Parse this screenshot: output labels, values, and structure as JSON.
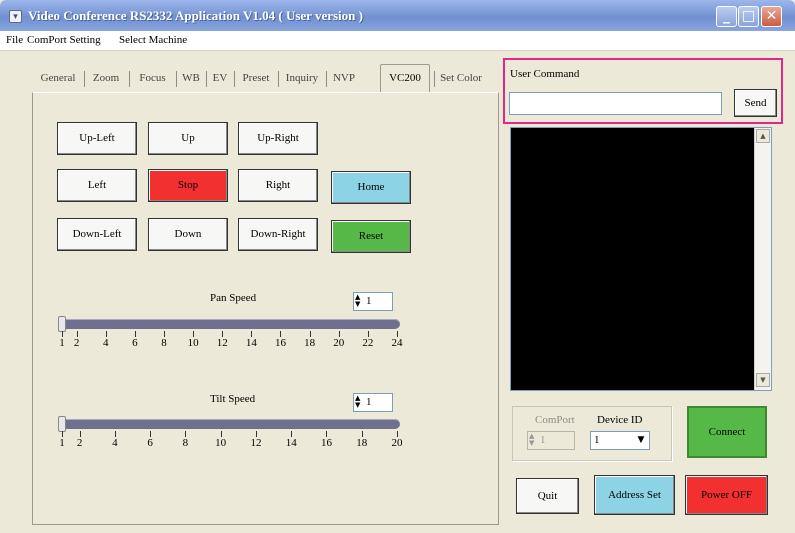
{
  "window": {
    "title": "Video Conference RS2332 Application V1.04 ( User version )"
  },
  "menu": [
    "File",
    "ComPort Setting",
    "Select Machine"
  ],
  "tabs": [
    "General",
    "Zoom",
    "Focus",
    "WB",
    "EV",
    "Preset",
    "Inquiry",
    "NVP",
    "VC200",
    "Set Color"
  ],
  "active_tab": "VC200",
  "ptz": {
    "up_left": "Up-Left",
    "up": "Up",
    "up_right": "Up-Right",
    "left": "Left",
    "stop": "Stop",
    "right": "Right",
    "home": "Home",
    "down_left": "Down-Left",
    "down": "Down",
    "down_right": "Down-Right",
    "reset": "Reset"
  },
  "pan_speed": {
    "label": "Pan Speed",
    "value": "1",
    "ticks": [
      "1",
      "2",
      "4",
      "6",
      "8",
      "10",
      "12",
      "14",
      "16",
      "18",
      "20",
      "22",
      "24"
    ]
  },
  "tilt_speed": {
    "label": "Tilt Speed",
    "value": "1",
    "ticks": [
      "1",
      "2",
      "4",
      "6",
      "8",
      "10",
      "12",
      "14",
      "16",
      "18",
      "20"
    ]
  },
  "user_command": {
    "label": "User Command",
    "value": "",
    "send": "Send"
  },
  "comport": {
    "label": "ComPort",
    "value": "1"
  },
  "device_id": {
    "label": "Device ID",
    "value": "1"
  },
  "buttons": {
    "connect": "Connect",
    "quit": "Quit",
    "address_set": "Address Set",
    "power_off": "Power OFF"
  },
  "colors": {
    "stop": "#f2302f",
    "home": "#8dd3e6",
    "reset": "#56b947",
    "connect": "#56b947",
    "address_set": "#8dd3e6",
    "power_off": "#f2302f",
    "highlight": "#e0288a"
  }
}
